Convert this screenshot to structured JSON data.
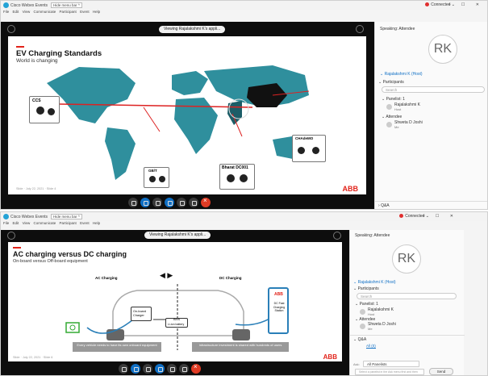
{
  "top": {
    "titlebar": {
      "app_title": "Cisco Webex Events",
      "hide_bar": "Hide menu bar ^",
      "connected": "Connected",
      "win_controls": "– ☐ ✕"
    },
    "menu": [
      "File",
      "Edit",
      "View",
      "Communicate",
      "Participant",
      "Event",
      "Help"
    ],
    "sharing_label": "Viewing Rajalakshmi K's appli...",
    "slide": {
      "title": "EV Charging Standards",
      "subtitle": "World is changing",
      "connectors": [
        "CCS",
        "GB/T",
        "Bharat DC001",
        "CHAdeMO"
      ],
      "footer_left": "Slide",
      "footer_date": "July 22, 2021",
      "footer_page": "Slide 4",
      "logo": "ABB"
    },
    "panel": {
      "speaking": "Speaking: Attendee",
      "avatar": "RK",
      "host_row": "Rajalakshmi K (Host)",
      "participants_header": "Participants",
      "search_placeholder": "Search",
      "panelists": "Panelist: 1",
      "panelist_name": "Rajalakshmi K",
      "panelist_role": "Host",
      "attendee_header": "Attendee",
      "attendee_name": "Shweta D Joshi",
      "attendee_role": "Me",
      "qa": "Q&A"
    }
  },
  "bottom": {
    "titlebar": {
      "app_title": "Cisco Webex Events",
      "hide_bar": "Hide menu bar ^",
      "connected": "Connected",
      "win_controls": "– ☐ ✕"
    },
    "menu": [
      "File",
      "Edit",
      "View",
      "Communicate",
      "Participant",
      "Event",
      "Help"
    ],
    "sharing_label": "Viewing Rajalakshmi K's appli...",
    "slide": {
      "title": "AC charging versus DC charging",
      "subtitle": "On-board versus Off-board equipment",
      "ac_label": "AC Charging",
      "dc_label": "DC Charging",
      "onboard_charger": "On-board Charger",
      "bms": "BMS",
      "battery": "Li-ion battery",
      "dc_station_logo": "ABB",
      "dc_station": "DC Fast Charging Station",
      "caption_left": "Every vehicle needs to have its own onboard equipment",
      "caption_right": "Infrastructure investment is shared with hundreds of users",
      "footer_left": "Slide",
      "footer_date": "July 22, 2021",
      "footer_page": "Slide 6",
      "logo": "ABB"
    },
    "panel": {
      "speaking": "Speaking: Attendee",
      "avatar": "RK",
      "host_row": "Rajalakshmi K (Host)",
      "participants_header": "Participants",
      "search_placeholder": "Search",
      "panelists": "Panelist: 1",
      "panelist_name": "Rajalakshmi K",
      "panelist_role": "Host",
      "attendee_header": "Attendee",
      "attendee_name": "Shweta D Joshi",
      "attendee_role": "Me",
      "qa": "Q&A",
      "qa_tab": "All (0)",
      "ask_label": "Ask:",
      "ask_target": "All Panelists",
      "ask_placeholder": "Select a panelist in the Ask menu first and then type your question.",
      "send": "Send"
    }
  },
  "colors": {
    "abb_red": "#e2231a",
    "webex_blue": "#0f6fc5",
    "end_red": "#e03b24",
    "map_teal": "#2f8f9d",
    "china": "#111111"
  }
}
